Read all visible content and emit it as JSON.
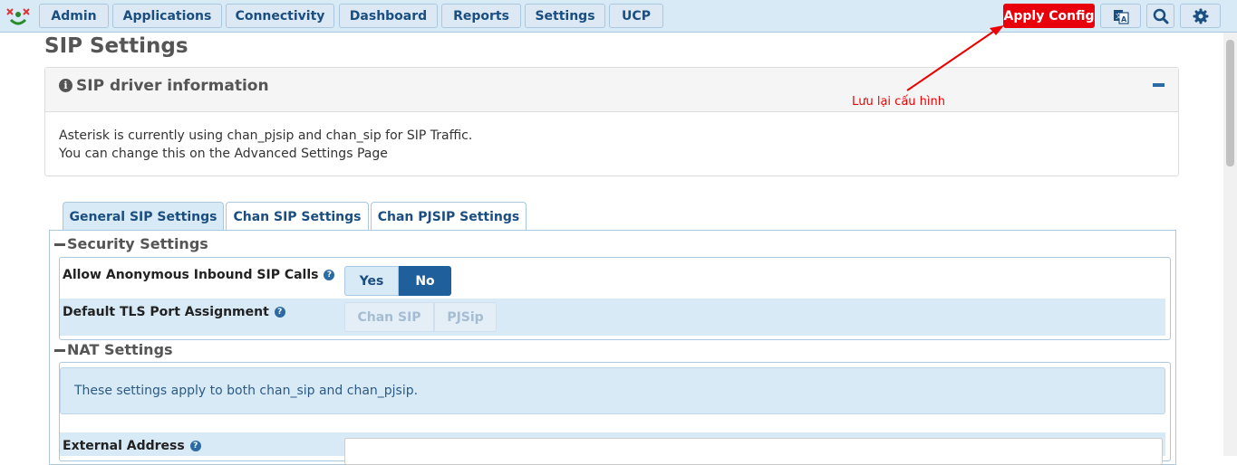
{
  "nav": {
    "items": [
      {
        "label": "Admin"
      },
      {
        "label": "Applications"
      },
      {
        "label": "Connectivity"
      },
      {
        "label": "Dashboard"
      },
      {
        "label": "Reports"
      },
      {
        "label": "Settings"
      },
      {
        "label": "UCP"
      }
    ],
    "apply_label": "Apply Config",
    "icons": [
      "language-icon",
      "search-icon",
      "gear-icon"
    ]
  },
  "page": {
    "title": "SIP Settings"
  },
  "annotation": {
    "text": "Lưu lại cấu hình"
  },
  "driver_panel": {
    "title": "SIP driver information",
    "line1": "Asterisk is currently using chan_pjsip and chan_sip for SIP Traffic.",
    "line2": "You can change this on the Advanced Settings Page"
  },
  "tabs": [
    {
      "label": "General SIP Settings",
      "active": true
    },
    {
      "label": "Chan SIP Settings",
      "active": false
    },
    {
      "label": "Chan PJSIP Settings",
      "active": false
    }
  ],
  "security": {
    "title": "Security Settings",
    "anon_label": "Allow Anonymous Inbound SIP Calls",
    "anon_options": [
      "Yes",
      "No"
    ],
    "anon_selected": "No",
    "tls_label": "Default TLS Port Assignment",
    "tls_options": [
      "Chan SIP",
      "PJSip"
    ]
  },
  "nat": {
    "title": "NAT Settings",
    "note": "These settings apply to both chan_sip and chan_pjsip.",
    "external_label": "External Address",
    "external_value": ""
  },
  "colors": {
    "accent": "#1f5f9b",
    "apply": "#e8000b",
    "annotation": "#ee0000"
  }
}
